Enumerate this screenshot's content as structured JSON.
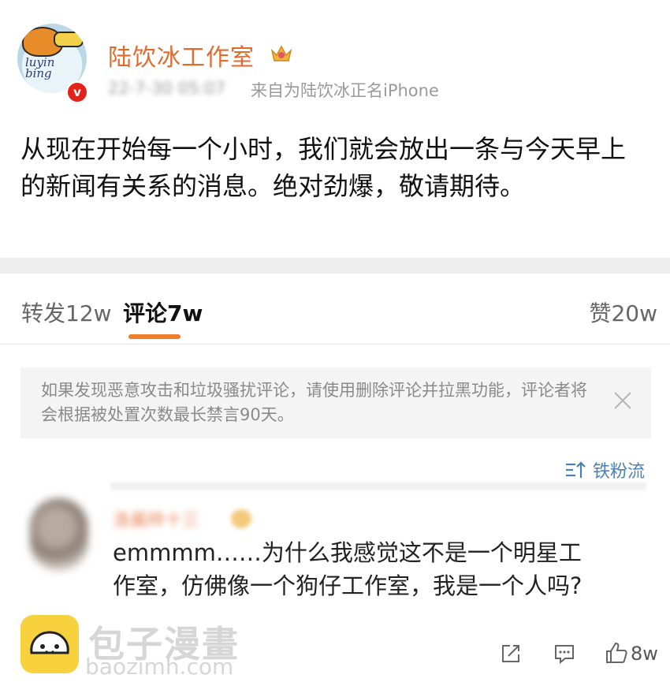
{
  "header": {
    "account_name": "陆饮冰工作室",
    "post_time": "22-7-30 05:07",
    "post_source": "来自为陆饮冰正名iPhone",
    "avatar_text": "luyin bing"
  },
  "post": {
    "text": "从现在开始每一个小时，我们就会放出一条与今天早上的新闻有关系的消息。绝对劲爆，敬请期待。"
  },
  "tabs": {
    "repost": "转发12w",
    "comment": "评论7w",
    "like": "赞20w"
  },
  "notice": {
    "text": "如果发现恶意攻击和垃圾骚扰评论，请使用删除评论并拉黑功能，评论者将会根据被处置次数最长禁言90天。"
  },
  "sort": {
    "label": "铁粉流"
  },
  "comment": {
    "name": "洛酱梓十三",
    "text": "emmmm……为什么我感觉这不是一个明星工作室，仿佛像一个狗仔工作室，我是一个人吗?",
    "like_count": "8w"
  },
  "watermark": {
    "title": "包子漫畫",
    "url": "baozimh.com"
  },
  "colors": {
    "brand_orange": "#e06b2c",
    "tab_underline": "#ee7f2d",
    "link_blue": "#4a7fb8",
    "verified_red": "#e2231a"
  },
  "icons": [
    "verified-icon",
    "crown-icon",
    "close-icon",
    "sort-icon",
    "share-icon",
    "reply-icon",
    "like-icon"
  ]
}
